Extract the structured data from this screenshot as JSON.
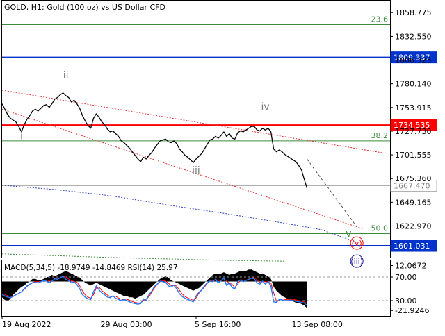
{
  "header": {
    "symbol_line": "GOLD, H1:  Gold (100 oz) vs US Dollar CFD"
  },
  "colors": {
    "grid": "#c8c8c8",
    "price_line": "#000000",
    "blue_level": "#0033cc",
    "red_level": "#ff0000",
    "fib_line": "#3d8a3d",
    "current_price_line": "#b0b0b0",
    "channel_red": "#e03030",
    "ma_blue": "#2a3fb8",
    "ma_green": "#3d8a3d",
    "wave_label": "#7a7a7a",
    "macd_fill": "#000000",
    "rsi_red": "#ff0000",
    "rsi_blue": "#1e78ff"
  },
  "chart_data": [
    {
      "type": "line",
      "panel": "main",
      "price_scale_ticks": [
        "1858.775",
        "1832.550",
        "1806.325",
        "1780.140",
        "1753.915",
        "1727.730",
        "1701.555",
        "1675.360",
        "1649.165",
        "1622.970"
      ],
      "ylim": [
        1588.0,
        1872.0
      ],
      "levels": [
        {
          "name": "blue-level-1809",
          "label": "1809.337",
          "value": 1809.337,
          "style": "blue-solid"
        },
        {
          "name": "red-level-1734",
          "label": "1734.535",
          "value": 1734.535,
          "style": "red-solid"
        },
        {
          "name": "current-price",
          "label": "1667.470",
          "value": 1667.47,
          "style": "gray-solid"
        },
        {
          "name": "blue-level-1601",
          "label": "1601.031",
          "value": 1601.031,
          "style": "blue-solid"
        }
      ],
      "fib_levels": [
        {
          "label": "23.6",
          "value": 1845.5
        },
        {
          "label": "38.2",
          "value": 1717.0
        },
        {
          "label": "50.0",
          "value": 1614.5
        }
      ],
      "wave_labels": [
        {
          "text": "i",
          "t": 7,
          "value": 1719
        },
        {
          "text": "ii",
          "t": 23,
          "value": 1786
        },
        {
          "text": "iii",
          "t": 70,
          "value": 1681
        },
        {
          "text": "iv",
          "t": 95,
          "value": 1751
        },
        {
          "text": "v",
          "t": 125,
          "value": 1611
        }
      ],
      "circled_labels": [
        {
          "text": "(v)",
          "t": 128,
          "value": 1601,
          "color": "#ff0000"
        },
        {
          "text": "(iii)",
          "t": 128,
          "value": 1581,
          "color": "#1a1aa0"
        }
      ],
      "price_series": [
        1758,
        1752,
        1746,
        1742,
        1740,
        1738,
        1733,
        1727,
        1735,
        1741,
        1745,
        1750,
        1752,
        1750,
        1753,
        1756,
        1757,
        1754,
        1758,
        1763,
        1765,
        1768,
        1770,
        1767,
        1765,
        1760,
        1762,
        1758,
        1753,
        1745,
        1739,
        1734,
        1731,
        1742,
        1747,
        1743,
        1738,
        1735,
        1730,
        1727,
        1728,
        1725,
        1722,
        1717,
        1715,
        1712,
        1709,
        1705,
        1701,
        1697,
        1694,
        1699,
        1697,
        1701,
        1704,
        1709,
        1713,
        1717,
        1718,
        1719,
        1716,
        1715,
        1717,
        1714,
        1708,
        1705,
        1701,
        1699,
        1696,
        1693,
        1697,
        1700,
        1703,
        1708,
        1713,
        1718,
        1719,
        1722,
        1720,
        1723,
        1727,
        1722,
        1725,
        1720,
        1719,
        1726,
        1728,
        1727,
        1729,
        1731,
        1733,
        1733,
        1729,
        1728,
        1731,
        1729,
        1731,
        1727,
        1708,
        1705,
        1707,
        1705,
        1702,
        1700,
        1698,
        1696,
        1694,
        1690,
        1685,
        1675,
        1665
      ],
      "projection": {
        "from_t": 110,
        "from_value": 1697,
        "to_t": 128,
        "to_value": 1622
      },
      "channel_upper": {
        "from_t": 0,
        "from_value": 1773,
        "to_t": 137,
        "to_value": 1704
      },
      "channel_lower": {
        "from_t": 0,
        "from_value": 1752,
        "to_t": 130,
        "to_value": 1620
      },
      "ma_blue": [
        {
          "t": 0,
          "value": 1668
        },
        {
          "t": 20,
          "value": 1663
        },
        {
          "t": 40,
          "value": 1656
        },
        {
          "t": 60,
          "value": 1646
        },
        {
          "t": 80,
          "value": 1637
        },
        {
          "t": 100,
          "value": 1627
        },
        {
          "t": 115,
          "value": 1619
        },
        {
          "t": 128,
          "value": 1605
        }
      ],
      "ma_green": [
        {
          "t": 0,
          "value": 1592
        },
        {
          "t": 40,
          "value": 1588
        },
        {
          "t": 80,
          "value": 1585
        },
        {
          "t": 102,
          "value": 1584
        }
      ]
    },
    {
      "type": "area",
      "panel": "indicator",
      "label": "MACD(5,34,5) -18.9749 -14.8469 RSI(14) 25.97",
      "scale_ticks": [
        "12.0672",
        "70.00",
        "30.00",
        "-21.9246"
      ],
      "ylim": [
        -26.0,
        16.0
      ],
      "rsi_scale": {
        "value_70": 70,
        "value_30": 30
      },
      "macd_histogram": [
        -12,
        -14,
        -15,
        -13,
        -10,
        -8,
        -6,
        -4,
        -3,
        -1,
        0,
        2,
        2,
        1,
        1,
        2,
        3,
        4,
        5,
        4,
        5,
        6,
        7,
        8,
        7,
        6,
        5,
        4,
        3,
        1,
        -1,
        -2,
        -3,
        -2,
        -1,
        -2,
        -3,
        -4,
        -5,
        -6,
        -7,
        -8,
        -9,
        -10,
        -11,
        -11,
        -12,
        -12,
        -13,
        -12,
        -11,
        -10,
        -8,
        -6,
        -4,
        -2,
        0,
        2,
        3,
        4,
        3,
        1,
        0,
        -1,
        -2,
        -3,
        -4,
        -5,
        -6,
        -7,
        -6,
        -5,
        -3,
        -1,
        1,
        3,
        5,
        6,
        6,
        6,
        7,
        6,
        5,
        6,
        6,
        7,
        8,
        8,
        8,
        9,
        9,
        8,
        7,
        6,
        6,
        5,
        4,
        2,
        -4,
        -7,
        -9,
        -11,
        -12,
        -13,
        -14,
        -15,
        -16,
        -16,
        -17,
        -18,
        -20
      ],
      "rsi_series": [
        40,
        38,
        36,
        35,
        37,
        40,
        42,
        45,
        50,
        55,
        58,
        60,
        61,
        60,
        62,
        64,
        63,
        60,
        63,
        67,
        66,
        69,
        71,
        66,
        64,
        60,
        62,
        57,
        50,
        40,
        36,
        33,
        32,
        45,
        55,
        48,
        43,
        40,
        36,
        35,
        38,
        34,
        32,
        30,
        32,
        30,
        28,
        26,
        25,
        24,
        25,
        33,
        30,
        40,
        46,
        54,
        58,
        63,
        62,
        61,
        55,
        53,
        56,
        50,
        42,
        37,
        34,
        32,
        30,
        28,
        38,
        44,
        48,
        55,
        60,
        63,
        62,
        66,
        60,
        64,
        68,
        56,
        60,
        52,
        50,
        62,
        65,
        62,
        64,
        66,
        68,
        67,
        60,
        58,
        63,
        58,
        62,
        55,
        28,
        27,
        32,
        31,
        30,
        30,
        31,
        30,
        29,
        28,
        27,
        26,
        22
      ]
    }
  ],
  "time_axis": {
    "labels": [
      {
        "text": "19 Aug 2022",
        "t": 0
      },
      {
        "text": "29 Aug 03:00",
        "t": 36
      },
      {
        "text": "5 Sep 16:00",
        "t": 70
      },
      {
        "text": "13 Sep 08:00",
        "t": 105
      }
    ]
  }
}
